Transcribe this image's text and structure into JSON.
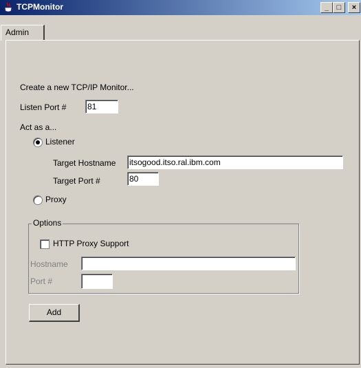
{
  "window": {
    "title": "TCPMonitor",
    "minimize_label": "_",
    "maximize_label": "□",
    "close_label": "×"
  },
  "tabs": [
    {
      "label": "Admin",
      "selected": true
    }
  ],
  "admin": {
    "heading": "Create a new TCP/IP Monitor...",
    "listen_port_label": "Listen Port #",
    "listen_port_value": "81",
    "act_as_label": "Act as a...",
    "listener_label": "Listener",
    "listener_selected": true,
    "target_hostname_label": "Target Hostname",
    "target_hostname_value": "itsogood.itso.ral.ibm.com",
    "target_port_label": "Target Port #",
    "target_port_value": "80",
    "proxy_label": "Proxy",
    "proxy_selected": false,
    "options": {
      "title": "Options",
      "http_proxy_label": "HTTP Proxy Support",
      "http_proxy_checked": false,
      "hostname_label": "Hostname",
      "hostname_value": "",
      "port_label": "Port #",
      "port_value": ""
    },
    "add_button_label": "Add"
  },
  "colors": {
    "titlebar_start": "#0a246a",
    "titlebar_end": "#a6caf0",
    "window_bg": "#d4d0c8",
    "disabled_text": "#808080"
  }
}
